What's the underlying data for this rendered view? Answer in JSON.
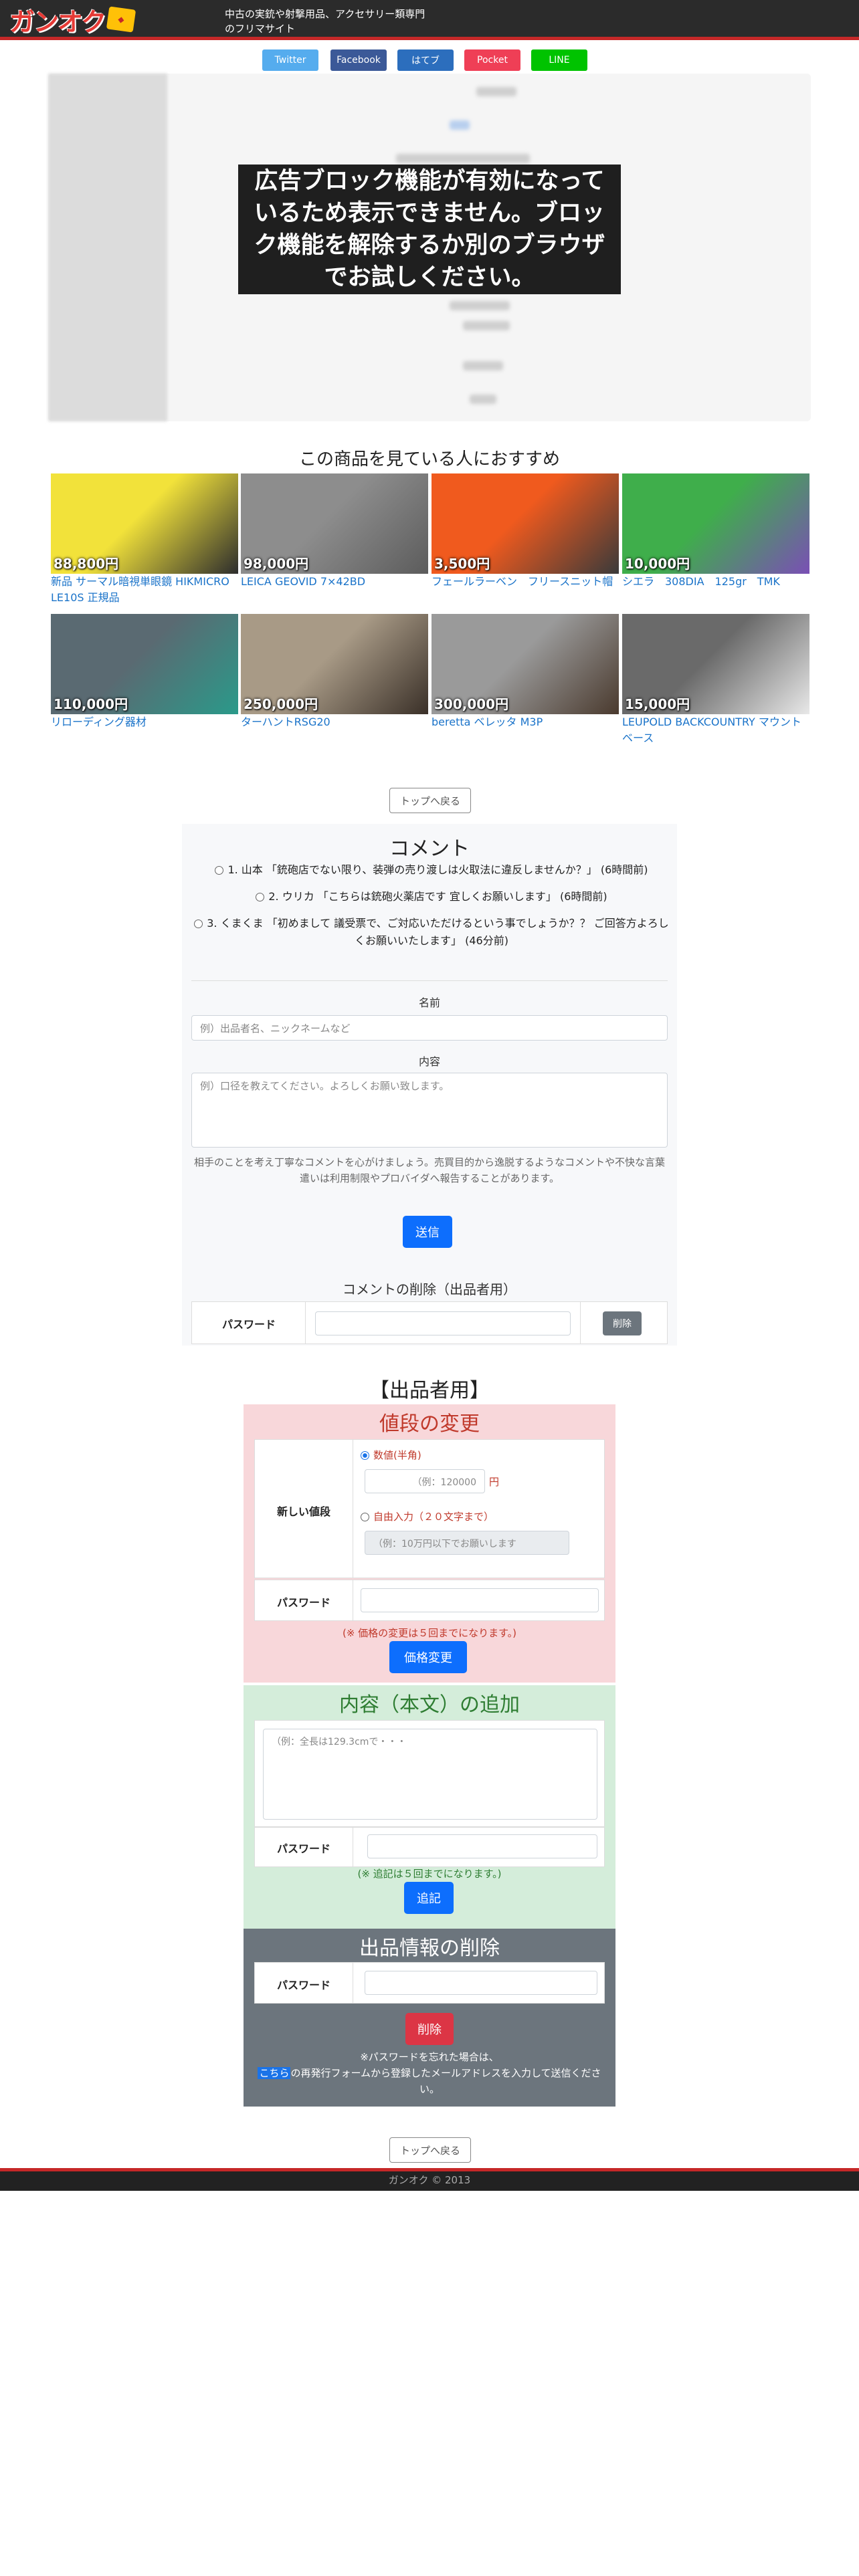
{
  "header": {
    "logo_text": "ガンオク",
    "tagline": "中古の実銃や射撃用品、アクセサリー類専門のフリマサイト"
  },
  "share": [
    {
      "label": "Twitter",
      "color": "#55acee"
    },
    {
      "label": "Facebook",
      "color": "#3b5998"
    },
    {
      "label": "はてブ",
      "color": "#2c6ebd"
    },
    {
      "label": "Pocket",
      "color": "#ef3f56"
    },
    {
      "label": "LINE",
      "color": "#00c300"
    }
  ],
  "adblock_message": "広告ブロック機能が有効になっているため表示できません。ブロック機能を解除するか別のブラウザでお試しください。",
  "recommend": {
    "title": "この商品を見ている人におすすめ",
    "items": [
      {
        "price": "88,800円",
        "name": "新品 サーマル暗視単眼鏡 HIKMICRO LE10S 正規品",
        "colors": [
          "#f2e23a",
          "#2d2d2d"
        ]
      },
      {
        "price": "98,000円",
        "name": "LEICA GEOVID 7×42BD",
        "colors": [
          "#8d8d8d",
          "#5c5c5c"
        ]
      },
      {
        "price": "3,500円",
        "name": "フェールラーベン　フリースニット帽",
        "colors": [
          "#f05a1e",
          "#3a3a3a"
        ]
      },
      {
        "price": "10,000円",
        "name": "シエラ　308DIA　125gr　TMK",
        "colors": [
          "#3fae4b",
          "#7a4fb5"
        ]
      },
      {
        "price": "110,000円",
        "name": "リローディング器材",
        "colors": [
          "#5a6a72",
          "#2a9a8a"
        ]
      },
      {
        "price": "250,000円",
        "name": "ターハントRSG20",
        "colors": [
          "#a89a86",
          "#3a3028"
        ]
      },
      {
        "price": "300,000円",
        "name": "beretta ベレッタ M3P",
        "colors": [
          "#9a9a9a",
          "#4a3a2e"
        ]
      },
      {
        "price": "15,000円",
        "name": "LEUPOLD BACKCOUNTRY マウントベース",
        "colors": [
          "#6a6a6a",
          "#e8e8e8"
        ]
      }
    ]
  },
  "top_button": "トップへ戻る",
  "comments": {
    "title": "コメント",
    "items": [
      "1. 山本 「銃砲店でない限り、装弾の売り渡しは火取法に違反しませんか？」 (6時間前)",
      "2. ウリカ 「こちらは銃砲火薬店です 宜しくお願いします」 (6時間前)",
      "3. くまくま 「初めまして 議受票で、ご対応いただけるという事でしょうか？？ ご回答方よろしくお願いいたします」 (46分前)"
    ],
    "name_label": "名前",
    "name_placeholder": "例）出品者名、ニックネームなど",
    "content_label": "内容",
    "content_placeholder": "例）口径を教えてください。よろしくお願い致します。",
    "note": "相手のことを考え丁寧なコメントを心がけましょう。売買目的から逸脱するようなコメントや不快な言葉遣いは利用制限やプロバイダへ報告することがあります。",
    "submit": "送信",
    "delete_title": "コメントの削除（出品者用）",
    "password_label": "パスワード",
    "delete_button": "削除"
  },
  "seller": {
    "title": "【出品者用】",
    "price_change": {
      "title": "値段の変更",
      "new_price_label": "新しい値段",
      "numeric_option": "数値(半角)",
      "numeric_placeholder": "（例：120000",
      "yen": "円",
      "free_option": "自由入力（２０文字まで）",
      "free_placeholder": "（例：10万円以下でお願いします",
      "password_label": "パスワード",
      "note": "(※ 価格の変更は５回までになります。)",
      "button": "価格変更"
    },
    "append": {
      "title": "内容（本文）の追加",
      "placeholder": "（例：全長は129.3cmで・・・",
      "password_label": "パスワード",
      "note": "(※ 追記は５回までになります。)",
      "button": "追記"
    },
    "delete": {
      "title": "出品情報の削除",
      "password_label": "パスワード",
      "button": "削除",
      "note_line1": "※パスワードを忘れた場合は、",
      "note_link": "こちら",
      "note_line2": "の再発行フォームから登録したメールアドレスを入力して送信ください。"
    }
  },
  "footer": "ガンオク © 2013"
}
